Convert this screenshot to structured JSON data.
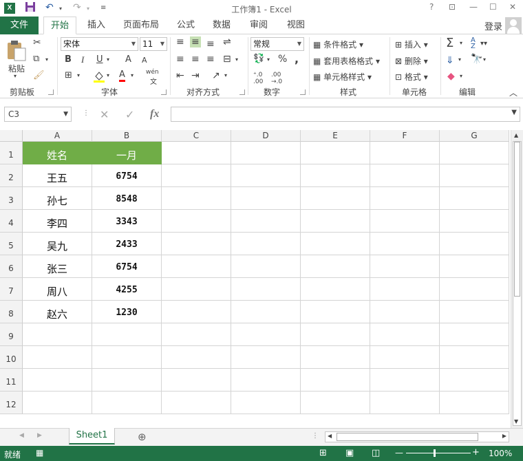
{
  "titlebar": {
    "logo": "X",
    "title": "工作簿1 - Excel",
    "help": "?",
    "restore_ribbon": "⊡",
    "minimize": "—",
    "maximize": "☐",
    "close": "✕"
  },
  "tabs": {
    "file": "文件",
    "items": [
      "开始",
      "插入",
      "页面布局",
      "公式",
      "数据",
      "审阅",
      "视图"
    ],
    "active": "开始",
    "login": "登录"
  },
  "ribbon": {
    "clipboard": {
      "paste": "粘贴",
      "label": "剪贴板"
    },
    "font": {
      "name": "宋体",
      "size": "11",
      "bold": "B",
      "italic": "I",
      "underline": "U",
      "grow": "A",
      "shrink": "A",
      "font_color": "A",
      "wen": "wén",
      "label": "字体"
    },
    "alignment": {
      "label": "对齐方式"
    },
    "number": {
      "format": "常规",
      "percent": "%",
      "comma": ",",
      "label": "数字"
    },
    "styles": {
      "conditional": "条件格式",
      "table": "套用表格格式",
      "cell": "单元格样式",
      "label": "样式"
    },
    "cells": {
      "insert": "插入",
      "delete": "删除",
      "format": "格式",
      "label": "单元格"
    },
    "editing": {
      "sum": "Σ",
      "sort": "A Z",
      "find": "🔍",
      "label": "编辑"
    }
  },
  "formula": {
    "namebox": "C3",
    "cancel": "✕",
    "enter": "✓",
    "fx": "fx",
    "value": ""
  },
  "columns": [
    "A",
    "B",
    "C",
    "D",
    "E",
    "F",
    "G"
  ],
  "rows": [
    "1",
    "2",
    "3",
    "4",
    "5",
    "6",
    "7",
    "8",
    "9",
    "10",
    "11",
    "12"
  ],
  "table": {
    "header": [
      "姓名",
      "一月"
    ],
    "data": [
      [
        "王五",
        "6754"
      ],
      [
        "孙七",
        "8548"
      ],
      [
        "李四",
        "3343"
      ],
      [
        "吴九",
        "2433"
      ],
      [
        "张三",
        "6754"
      ],
      [
        "周八",
        "4255"
      ],
      [
        "赵六",
        "1230"
      ]
    ],
    "header_color": "#70ad47"
  },
  "sheets": {
    "active": "Sheet1",
    "add": "⊕"
  },
  "status": {
    "ready": "就绪",
    "zoom": "100%",
    "minus": "—",
    "plus": "+"
  },
  "colors": {
    "brand": "#217346"
  }
}
